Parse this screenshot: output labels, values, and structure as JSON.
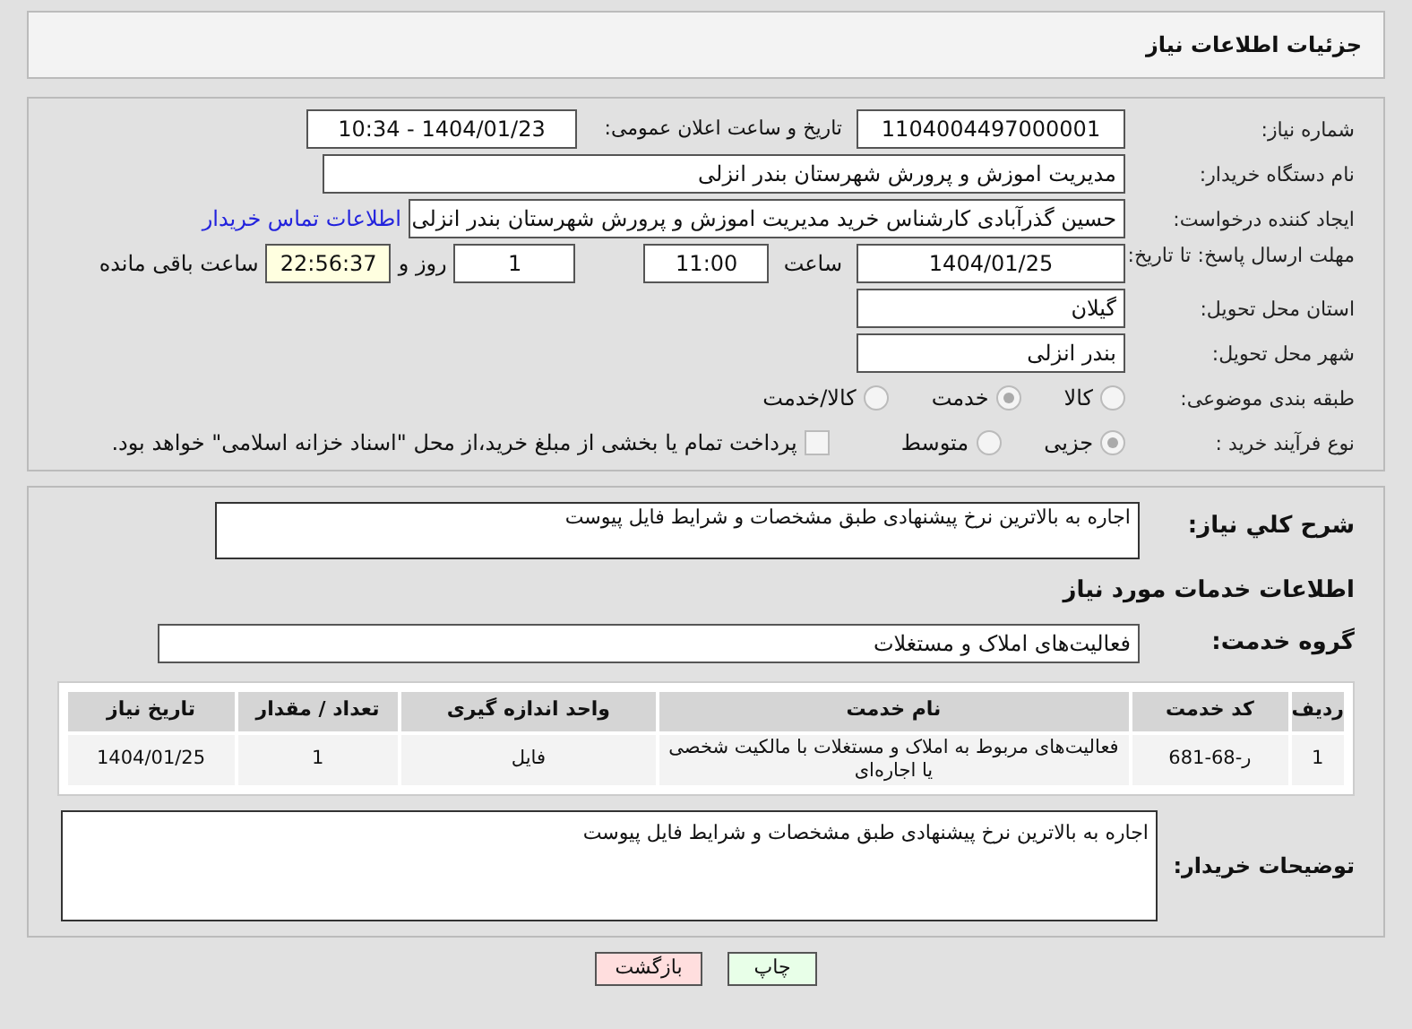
{
  "header": {
    "title": "جزئیات اطلاعات نیاز"
  },
  "need_number": {
    "label": "شماره نیاز:",
    "value": "1104004497000001"
  },
  "announce": {
    "label": "تاریخ و ساعت اعلان عمومی:",
    "value": "1404/01/23 - 10:34"
  },
  "buyer_org": {
    "label": "نام دستگاه خریدار:",
    "value": "مدیریت اموزش و پرورش شهرستان بندر انزلی"
  },
  "creator": {
    "label": "ایجاد کننده درخواست:",
    "value": "حسین گذرآبادی کارشناس خرید مدیریت اموزش و پرورش شهرستان بندر انزلی",
    "link": "اطلاعات تماس خریدار"
  },
  "deadline": {
    "label": "مهلت ارسال پاسخ: تا تاریخ:",
    "date": "1404/01/25",
    "time_label": "ساعت",
    "time": "11:00",
    "days": "1",
    "days_label": "روز و",
    "remaining": "22:56:37",
    "remaining_label": "ساعت باقی مانده"
  },
  "province": {
    "label": "استان محل تحویل:",
    "value": "گیلان"
  },
  "city": {
    "label": "شهر محل تحویل:",
    "value": "بندر انزلی"
  },
  "category": {
    "label": "طبقه بندی موضوعی:",
    "options": [
      {
        "label": "کالا",
        "selected": false
      },
      {
        "label": "خدمت",
        "selected": true
      },
      {
        "label": "کالا/خدمت",
        "selected": false
      }
    ]
  },
  "process": {
    "label": "نوع فرآیند خرید :",
    "options": [
      {
        "label": "جزیی",
        "selected": true
      },
      {
        "label": "متوسط",
        "selected": false
      }
    ],
    "payment": {
      "label": "پرداخت تمام یا بخشی از مبلغ خرید،از محل \"اسناد خزانه اسلامی\" خواهد بود.",
      "checked": false
    }
  },
  "description": {
    "label": "شرح کلي نياز:",
    "value": "اجاره به بالاترین نرخ پیشنهادی طبق  مشخصات  و شرایط فایل  پیوست"
  },
  "services_title": "اطلاعات خدمات مورد نیاز",
  "service_group": {
    "label": "گروه خدمت:",
    "value": "فعالیت‌های  املاک و مستغلات"
  },
  "table": {
    "columns": [
      "ردیف",
      "کد خدمت",
      "نام خدمت",
      "واحد اندازه گیری",
      "تعداد / مقدار",
      "تاریخ نیاز"
    ],
    "rows": [
      [
        "1",
        "ر-68-681",
        "فعالیت‌های مربوط به املاک و مستغلات با مالکیت شخصی یا اجاره‌ای",
        "فایل",
        "1",
        "1404/01/25"
      ]
    ]
  },
  "buyer_notes": {
    "label": "توضیحات خریدار:",
    "value": "اجاره به بالاترین نرخ پیشنهادی طبق  مشخصات  و شرایط فایل  پیوست"
  },
  "buttons": [
    {
      "label": "چاپ",
      "kind": "print"
    },
    {
      "label": "بازگشت",
      "kind": "back"
    }
  ]
}
